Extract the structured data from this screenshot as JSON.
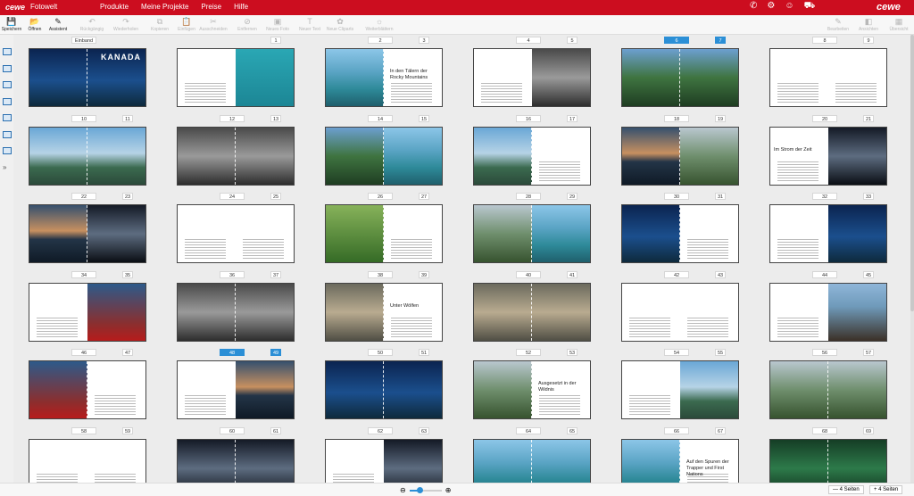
{
  "topbar": {
    "logo": "cewe",
    "app_name": "Fotowelt",
    "menu": [
      "Produkte",
      "Meine Projekte",
      "Preise",
      "Hilfe"
    ],
    "icons": [
      "phone-icon",
      "gear-icon",
      "user-icon",
      "cart-icon"
    ],
    "brand": "cewe"
  },
  "toolbar": {
    "items": [
      {
        "label": "Speichern",
        "icon": "save-icon",
        "enabled": true
      },
      {
        "label": "Öffnen",
        "icon": "open-icon",
        "enabled": true
      },
      {
        "label": "Assistent",
        "icon": "wand-icon",
        "enabled": true
      },
      {
        "label": "Rückgängig",
        "icon": "undo-icon",
        "enabled": false
      },
      {
        "label": "Wiederholen",
        "icon": "redo-icon",
        "enabled": false
      },
      {
        "label": "Kopieren",
        "icon": "copy-icon",
        "enabled": false
      },
      {
        "label": "Einfügen",
        "icon": "paste-icon",
        "enabled": false
      },
      {
        "label": "Ausschneiden",
        "icon": "cut-icon",
        "enabled": false
      },
      {
        "label": "Entfernen",
        "icon": "delete-icon",
        "enabled": false
      },
      {
        "label": "Neues Foto",
        "icon": "photo-icon",
        "enabled": false
      },
      {
        "label": "Neuer Text",
        "icon": "text-icon",
        "enabled": false
      },
      {
        "label": "Neue Cliparts",
        "icon": "clipart-icon",
        "enabled": false
      },
      {
        "label": "Weiterblättern",
        "icon": "bulb-icon",
        "enabled": false
      },
      {
        "label": "Bearbeiten",
        "icon": "edit-icon",
        "enabled": false
      },
      {
        "label": "Ansichten",
        "icon": "view-icon",
        "enabled": false
      },
      {
        "label": "Übersicht",
        "icon": "overview-icon",
        "enabled": false
      }
    ]
  },
  "sidebar": {
    "icons": [
      "layout-icon",
      "photos-icon",
      "pages-icon",
      "layouts-icon",
      "backgrounds-icon",
      "cliparts-icon",
      "frames-icon",
      "expand-icon"
    ]
  },
  "spreads": [
    {
      "left": "Einband",
      "right": "",
      "text": "KANADA"
    },
    {
      "left": "",
      "right": "1",
      "text": ""
    },
    {
      "left": "2",
      "right": "3",
      "text": "In den Tälern der Rocky Mountains"
    },
    {
      "left": "4",
      "right": "5",
      "text": ""
    },
    {
      "left": "6",
      "right": "7",
      "text": "",
      "selected": true
    },
    {
      "left": "8",
      "right": "9",
      "text": ""
    },
    {
      "left": "10",
      "right": "11",
      "text": ""
    },
    {
      "left": "12",
      "right": "13",
      "text": ""
    },
    {
      "left": "14",
      "right": "15",
      "text": ""
    },
    {
      "left": "16",
      "right": "17",
      "text": ""
    },
    {
      "left": "18",
      "right": "19",
      "text": ""
    },
    {
      "left": "20",
      "right": "21",
      "text": "Im Strom der Zeit"
    },
    {
      "left": "22",
      "right": "23",
      "text": ""
    },
    {
      "left": "24",
      "right": "25",
      "text": ""
    },
    {
      "left": "26",
      "right": "27",
      "text": ""
    },
    {
      "left": "28",
      "right": "29",
      "text": ""
    },
    {
      "left": "30",
      "right": "31",
      "text": ""
    },
    {
      "left": "32",
      "right": "33",
      "text": ""
    },
    {
      "left": "34",
      "right": "35",
      "text": ""
    },
    {
      "left": "36",
      "right": "37",
      "text": ""
    },
    {
      "left": "38",
      "right": "39",
      "text": "Unter Wölfen"
    },
    {
      "left": "40",
      "right": "41",
      "text": ""
    },
    {
      "left": "42",
      "right": "43",
      "text": ""
    },
    {
      "left": "44",
      "right": "45",
      "text": ""
    },
    {
      "left": "46",
      "right": "47",
      "text": ""
    },
    {
      "left": "48",
      "right": "49",
      "text": "",
      "selected": true
    },
    {
      "left": "50",
      "right": "51",
      "text": ""
    },
    {
      "left": "52",
      "right": "53",
      "text": "Ausgesetzt in der Wildnis"
    },
    {
      "left": "54",
      "right": "55",
      "text": ""
    },
    {
      "left": "56",
      "right": "57",
      "text": ""
    },
    {
      "left": "58",
      "right": "59",
      "text": ""
    },
    {
      "left": "60",
      "right": "61",
      "text": ""
    },
    {
      "left": "62",
      "right": "63",
      "text": ""
    },
    {
      "left": "64",
      "right": "65",
      "text": ""
    },
    {
      "left": "66",
      "right": "67",
      "text": "Auf den Spuren der Trapper und First Nations"
    },
    {
      "left": "68",
      "right": "69",
      "text": ""
    }
  ],
  "bottombar": {
    "remove_pages": "— 4 Seiten",
    "add_pages": "+ 4 Seiten",
    "zoom_level": 0.3
  }
}
